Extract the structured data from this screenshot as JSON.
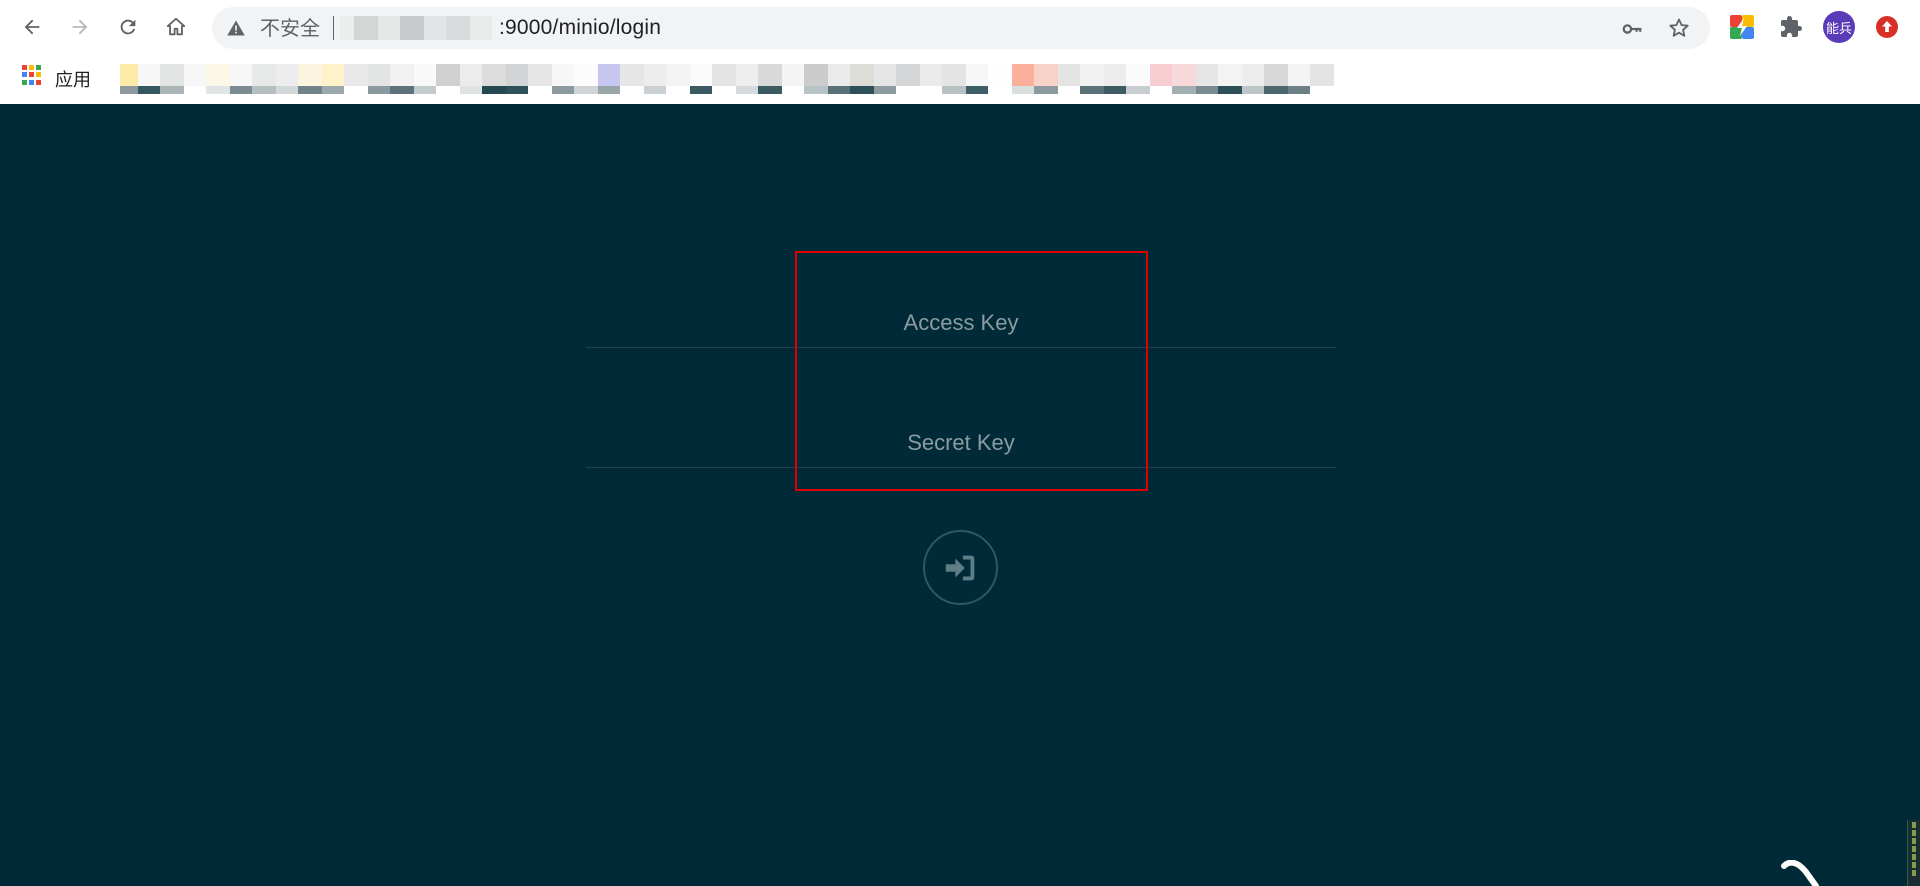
{
  "browser": {
    "security_label": "不安全",
    "url_suffix": ":9000/minio/login",
    "avatar_text": "能兵",
    "bookmarks_apps_label": "应用",
    "icons": {
      "back": "back-arrow-icon",
      "forward": "forward-arrow-icon",
      "reload": "reload-icon",
      "home": "home-icon",
      "warning": "warning-triangle-icon",
      "key": "key-icon",
      "star": "star-icon",
      "puzzle": "puzzle-icon",
      "update": "update-arrow-icon",
      "apps": "apps-grid-icon"
    }
  },
  "login": {
    "access_key_placeholder": "Access Key",
    "secret_key_placeholder": "Secret Key",
    "submit_icon": "sign-in-icon"
  },
  "colors": {
    "background": "#002a37",
    "highlight": "#e00000",
    "field_line": "#244250",
    "placeholder": "#8b9ba2"
  }
}
